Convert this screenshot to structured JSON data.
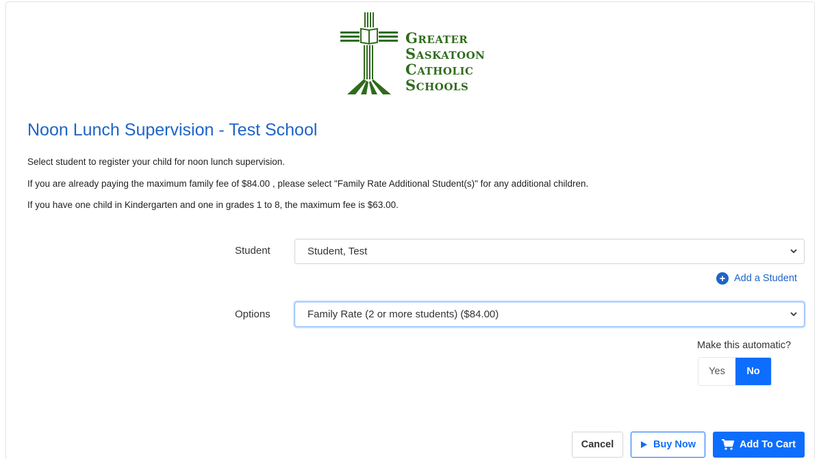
{
  "logo": {
    "lines": [
      "Greater",
      "Saskatoon",
      "Catholic",
      "Schools"
    ],
    "color": "#2f6b1d"
  },
  "page": {
    "title": "Noon Lunch Supervision - Test School",
    "description": [
      "Select student to register your child for noon lunch supervision.",
      "If you are already paying the maximum family fee of $84.00 , please select \"Family Rate Additional Student(s)\" for any additional children.",
      "If you have one child in Kindergarten and one in grades 1 to 8, the maximum fee is $63.00."
    ]
  },
  "form": {
    "student": {
      "label": "Student",
      "selected": "Student, Test"
    },
    "add_student": {
      "icon": "plus-circle-icon",
      "label": "Add a Student"
    },
    "options": {
      "label": "Options",
      "selected": "Family Rate (2 or more students) ($84.00)"
    },
    "automatic": {
      "label": "Make this automatic?",
      "yes_label": "Yes",
      "no_label": "No",
      "selected": "No"
    }
  },
  "actions": {
    "cancel_label": "Cancel",
    "buy_now_label": "Buy Now",
    "buy_now_icon": "play-icon",
    "add_to_cart_label": "Add To Cart",
    "add_to_cart_icon": "cart-icon"
  },
  "colors": {
    "accent": "#0d6efd",
    "title": "#1e64c8",
    "logo_green": "#2f6b1d"
  }
}
